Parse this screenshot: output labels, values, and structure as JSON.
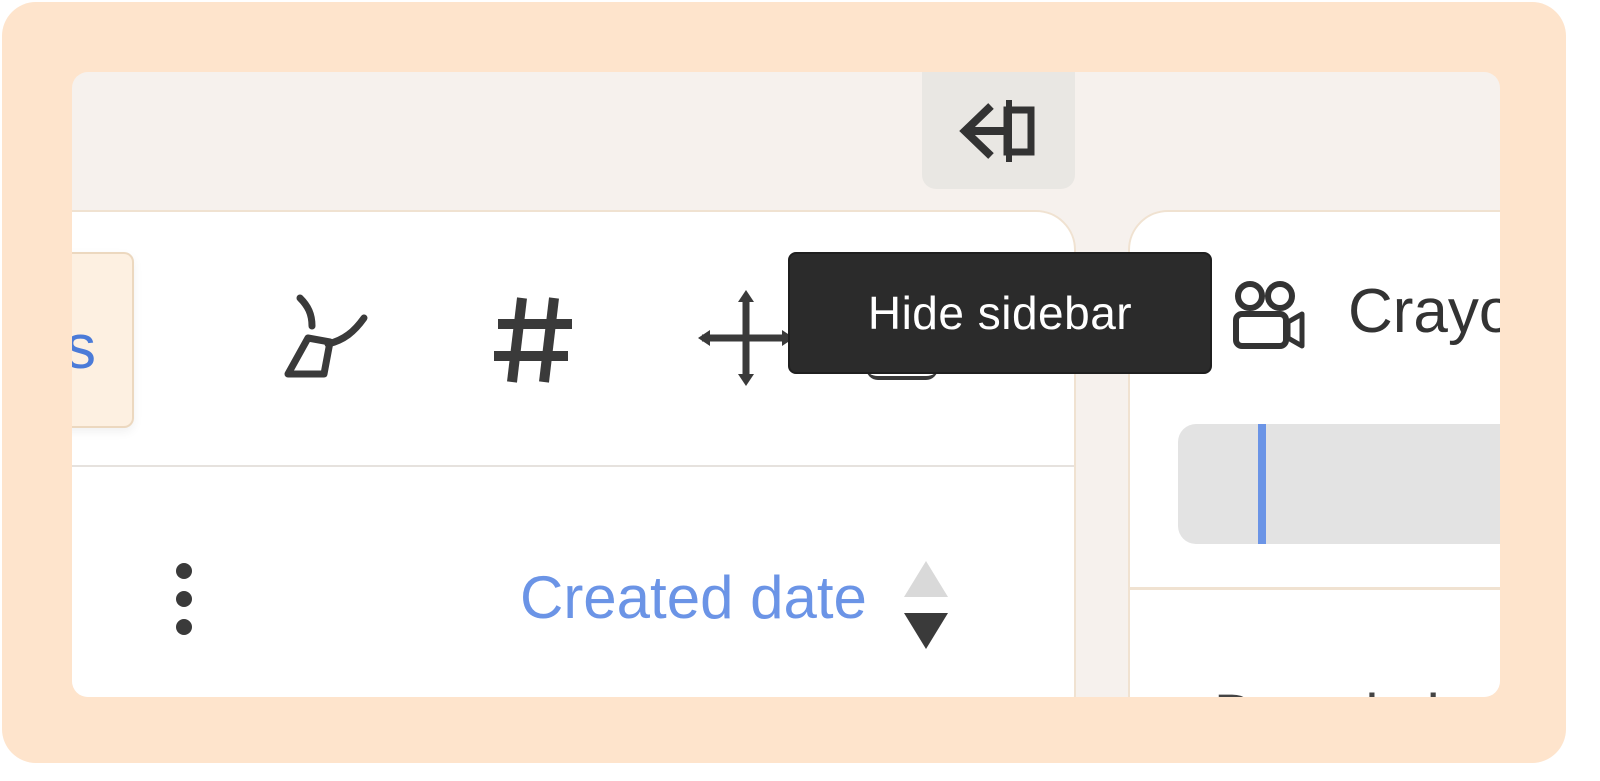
{
  "tooltip": {
    "text": "Hide sidebar"
  },
  "left_panel": {
    "pill_text": "s",
    "sort": {
      "label": "Created date"
    }
  },
  "right_panel": {
    "title": "Crayo",
    "description": "Description"
  },
  "colors": {
    "frame": "#fee4cc",
    "accent_blue": "#6b94e6",
    "tooltip_bg": "#2b2b2b"
  },
  "icons": {
    "collapse": "arrow-left-to-bar-icon",
    "toolbar": [
      "lasso-icon",
      "hash-icon",
      "move-arrows-icon"
    ],
    "header": "video-camera-icon"
  }
}
